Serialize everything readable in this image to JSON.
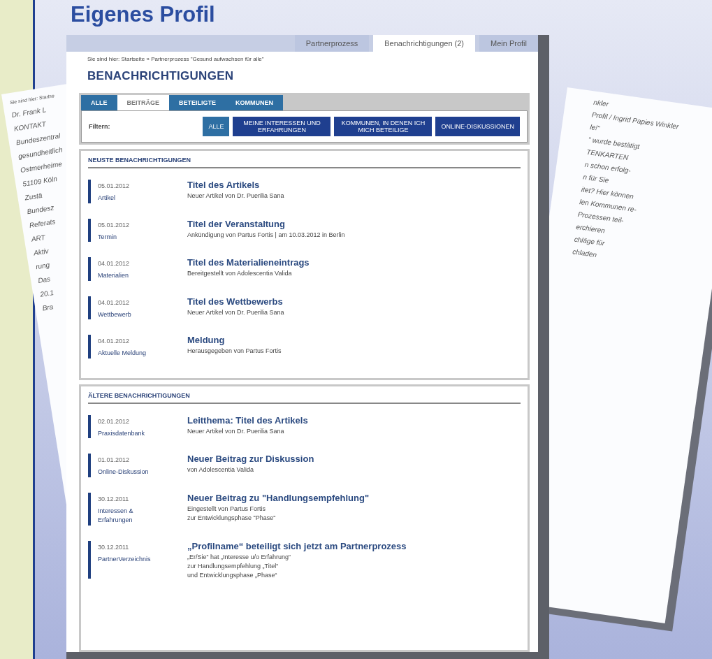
{
  "slide_title": "Eigenes Profil",
  "background_pages": [
    {
      "kind": "left",
      "texts": [
        "Sie sind hier: Startse",
        "Dr. Frank L",
        "KONTAKT",
        "Bundeszentral",
        "gesundheitlich",
        "Ostmerheime",
        "51109 Köln",
        "Zustä",
        "Bundesz",
        "Referats",
        "ART",
        "Aktiv",
        "rung",
        "Das",
        "20.1",
        "Bra"
      ]
    },
    {
      "kind": "right",
      "texts": [
        "nkler",
        "Profil / Ingrid Papies Winkler",
        "le!“",
        "“ wurde bestätigt",
        "TENKARTEN",
        "n schon erfolg-",
        "n für Sie",
        "itet? Hier können",
        "len Kommunen re-",
        "Prozessen teil-",
        "erchieren",
        "chläge für",
        "chladen"
      ]
    }
  ],
  "nav_tabs": [
    {
      "label": "Partnerprozess",
      "selected": false
    },
    {
      "label": "Benachrichtigungen (2)",
      "selected": true
    },
    {
      "label": "Mein Profil",
      "selected": false
    }
  ],
  "breadcrumb": "Sie sind hier: Startseite » Partnerprozess \"Gesund aufwachsen für alle\"",
  "heading": "BENACHRICHTIGUNGEN",
  "tabs": [
    {
      "label": "ALLE",
      "selected": false
    },
    {
      "label": "BEITRÄGE",
      "selected": true
    },
    {
      "label": "BETEILIGTE",
      "selected": false
    },
    {
      "label": "KOMMUNEN",
      "selected": false
    }
  ],
  "filter_label": "Filtern:",
  "filters": [
    {
      "label": "ALLE",
      "selected": true
    },
    {
      "label": "MEINE INTERESSEN UND ERFAHRUNGEN",
      "selected": false
    },
    {
      "label": "KOMMUNEN, IN DENEN ICH MICH BETEILIGE",
      "selected": false
    },
    {
      "label": "ONLINE-DISKUSSIONEN",
      "selected": false
    }
  ],
  "sections": [
    {
      "title": "NEUSTE BENACHRICHTIGUNGEN",
      "items": [
        {
          "date": "05.01.2012",
          "category": "Artikel",
          "title": "Titel des Artikels",
          "lines": [
            "Neuer Artikel von Dr. Puerilia Sana"
          ]
        },
        {
          "date": "05.01.2012",
          "category": "Termin",
          "title": "Titel der Veranstaltung",
          "lines": [
            "Ankündigung von Partus Fortis | am 10.03.2012 in Berlin"
          ]
        },
        {
          "date": "04.01.2012",
          "category": "Materialien",
          "title": "Titel des Materialieneintrags",
          "lines": [
            "Bereitgestellt von Adolescentia Valida"
          ]
        },
        {
          "date": "04.01.2012",
          "category": "Wettbewerb",
          "title": "Titel des Wettbewerbs",
          "lines": [
            "Neuer Artikel von Dr. Puerilia Sana"
          ]
        },
        {
          "date": "04.01.2012",
          "category": "Aktuelle Meldung",
          "title": "Meldung",
          "lines": [
            "Herausgegeben von Partus Fortis"
          ]
        }
      ]
    },
    {
      "title": "ÄLTERE BENACHRICHTIGUNGEN",
      "items": [
        {
          "date": "02.01.2012",
          "category": "Praxisdatenbank",
          "title": "Leitthema: Titel des Artikels",
          "lines": [
            "Neuer Artikel von Dr. Puerilia Sana"
          ]
        },
        {
          "date": "01.01.2012",
          "category": "Online-Diskussion",
          "title": "Neuer Beitrag zur Diskussion",
          "lines": [
            "von Adolescentia Valida"
          ]
        },
        {
          "date": "30.12.2011",
          "category": "Interessen & Erfahrungen",
          "title": "Neuer Beitrag zu \"Handlungsempfehlung\"",
          "lines": [
            "Eingestellt von Partus Fortis",
            "zur Entwicklungsphase \"Phase\""
          ]
        },
        {
          "date": "30.12.2011",
          "category": "PartnerVerzeichnis",
          "title": "„Profilname“ beteiligt sich jetzt am Partnerprozess",
          "lines": [
            "„Er/Sie“ hat „Interesse u/o Erfahrung“",
            "zur Handlungsempfehlung „Titel“",
            "und Entwicklungsphase „Phase“"
          ]
        }
      ]
    }
  ]
}
